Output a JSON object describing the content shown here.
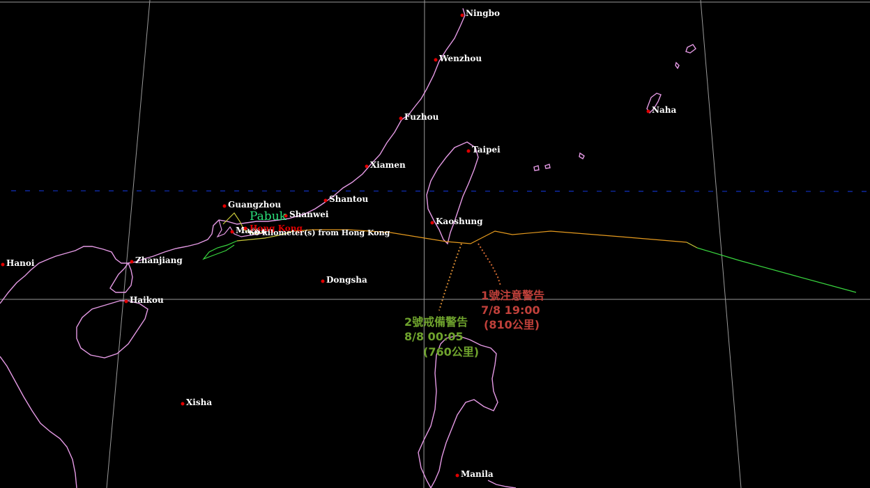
{
  "cities": [
    {
      "name": "Ningbo"
    },
    {
      "name": "Wenzhou"
    },
    {
      "name": "Fuzhou"
    },
    {
      "name": "Naha"
    },
    {
      "name": "Taipei"
    },
    {
      "name": "Xiamen"
    },
    {
      "name": "Shantou"
    },
    {
      "name": "Guangzhou"
    },
    {
      "name": "Shanwei"
    },
    {
      "name": "Kaoshung"
    },
    {
      "name": "Hanoi"
    },
    {
      "name": "Zhanjiang"
    },
    {
      "name": "Haikou"
    },
    {
      "name": "Dongsha"
    },
    {
      "name": "Xisha"
    },
    {
      "name": "Manila"
    },
    {
      "name": "Macau"
    },
    {
      "name": "Hong Kong"
    }
  ],
  "storm": {
    "name": "Pabuk",
    "distance_text": "60 kilometer(s) from Hong Kong",
    "track_colors": {
      "early": "#39d73f",
      "late": "#e59a1e",
      "mid": "#c9c93a"
    }
  },
  "warnings": [
    {
      "line1": "1號注意警告",
      "line2": "7/8 19:00",
      "line3": "(810公里)",
      "color": "#c0403a"
    },
    {
      "line1": "2號戒備警告",
      "line2": "8/8 00:05",
      "line3": "(760公里)",
      "color": "#6fa32d"
    }
  ],
  "colors": {
    "background": "#000000",
    "coastline": "#e59ae5",
    "grid": "#9a9a9a",
    "city_dot": "#e00000",
    "dashed_line": "#1030c0",
    "storm_label": "#2be07a",
    "hk_label": "#e00000"
  }
}
